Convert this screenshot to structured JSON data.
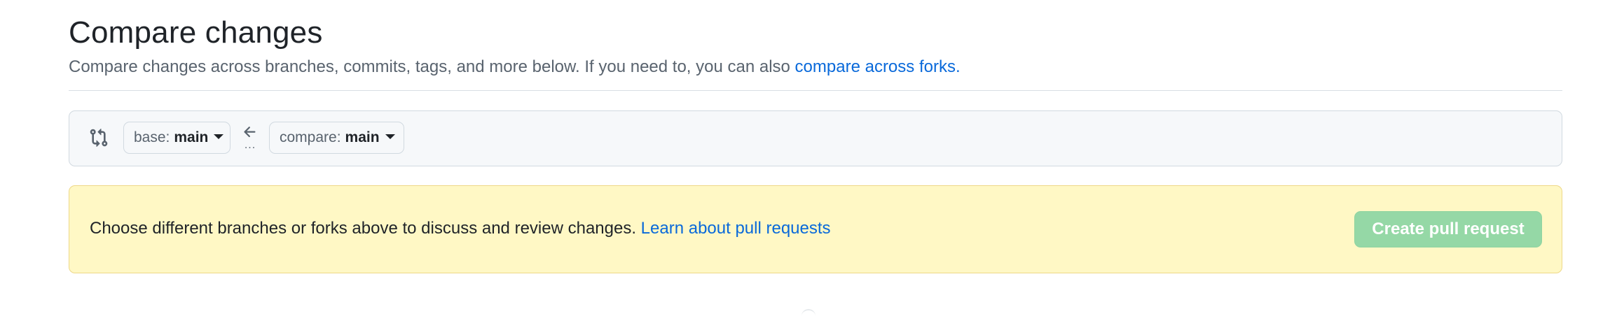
{
  "header": {
    "title": "Compare changes",
    "subtitle_prefix": "Compare changes across branches, commits, tags, and more below. If you need to, you can also ",
    "subtitle_link": "compare across forks."
  },
  "range_editor": {
    "base": {
      "prefix": "base:",
      "branch": "main"
    },
    "compare": {
      "prefix": "compare:",
      "branch": "main"
    },
    "separator": "..."
  },
  "flash": {
    "message": "Choose different branches or forks above to discuss and review changes. ",
    "link": "Learn about pull requests",
    "create_button_label": "Create pull request"
  },
  "colors": {
    "accent_link": "#0969da",
    "flash_background": "#fff8c5",
    "create_button_disabled": "#95d8a6"
  },
  "icons": {
    "compare": "git-compare-icon",
    "arrow": "arrow-left-icon",
    "caret": "caret-down-icon"
  }
}
